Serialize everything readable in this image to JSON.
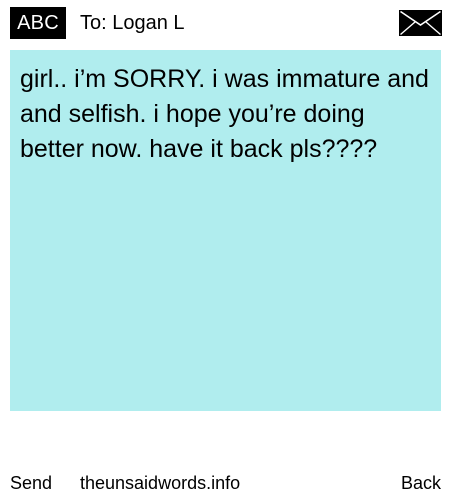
{
  "header": {
    "badge_label": "ABC",
    "recipient": "To: Logan L",
    "envelope_icon": "envelope-icon"
  },
  "message": {
    "text": "girl.. i’m SORRY. i was immature and and selfish. i hope you’re doing better now. have it back pls????",
    "background_color": "#b0edee"
  },
  "footer": {
    "send_label": "Send",
    "site_label": "theunsaidwords.info",
    "back_label": "Back"
  }
}
